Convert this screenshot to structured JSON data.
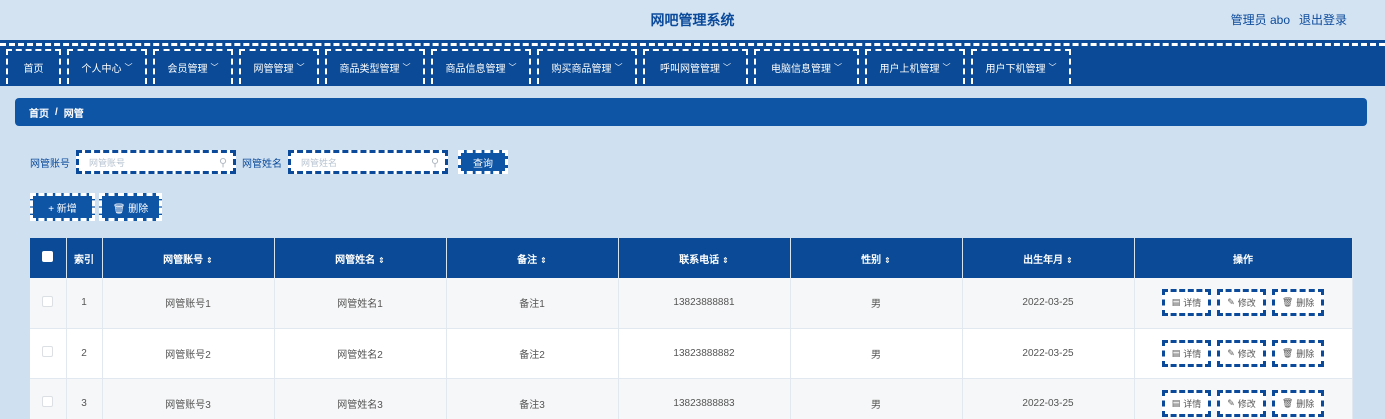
{
  "header": {
    "title": "网吧管理系统",
    "user": "管理员 abo",
    "logout": "退出登录"
  },
  "nav": {
    "items": [
      {
        "label": "首页",
        "caret": "",
        "width": 55
      },
      {
        "label": "个人中心",
        "caret": "﹀",
        "width": 80
      },
      {
        "label": "会员管理",
        "caret": "﹀",
        "width": 80
      },
      {
        "label": "网管管理",
        "caret": "﹀",
        "width": 80
      },
      {
        "label": "商品类型管理",
        "caret": "﹀",
        "width": 100
      },
      {
        "label": "商品信息管理",
        "caret": "﹀",
        "width": 100
      },
      {
        "label": "购买商品管理",
        "caret": "﹀",
        "width": 100
      },
      {
        "label": "呼叫网管管理",
        "caret": "﹀",
        "width": 105
      },
      {
        "label": "电脑信息管理",
        "caret": "﹀",
        "width": 105
      },
      {
        "label": "用户上机管理",
        "caret": "﹀",
        "width": 100
      },
      {
        "label": "用户下机管理",
        "caret": "﹀",
        "width": 100
      }
    ]
  },
  "breadcrumb": {
    "home": "首页",
    "sep": "/",
    "current": "网管"
  },
  "search": {
    "account_label": "网管账号",
    "account_placeholder": "网管账号",
    "name_label": "网管姓名",
    "name_placeholder": "网管姓名",
    "query_button": "查询"
  },
  "actions": {
    "add": "+ 新增",
    "delete": "🗑 删除"
  },
  "table": {
    "columns": [
      "索引",
      "网管账号",
      "网管姓名",
      "备注",
      "联系电话",
      "性别",
      "出生年月",
      "操作"
    ],
    "rows": [
      {
        "index": "1",
        "account": "网管账号1",
        "name": "网管姓名1",
        "note": "备注1",
        "phone": "13823888881",
        "gender": "男",
        "birth": "2022-03-25"
      },
      {
        "index": "2",
        "account": "网管账号2",
        "name": "网管姓名2",
        "note": "备注2",
        "phone": "13823888882",
        "gender": "男",
        "birth": "2022-03-25"
      },
      {
        "index": "3",
        "account": "网管账号3",
        "name": "网管姓名3",
        "note": "备注3",
        "phone": "13823888883",
        "gender": "男",
        "birth": "2022-03-25"
      }
    ],
    "ops": {
      "detail": "详情",
      "edit": "修改",
      "remove": "删除"
    }
  }
}
